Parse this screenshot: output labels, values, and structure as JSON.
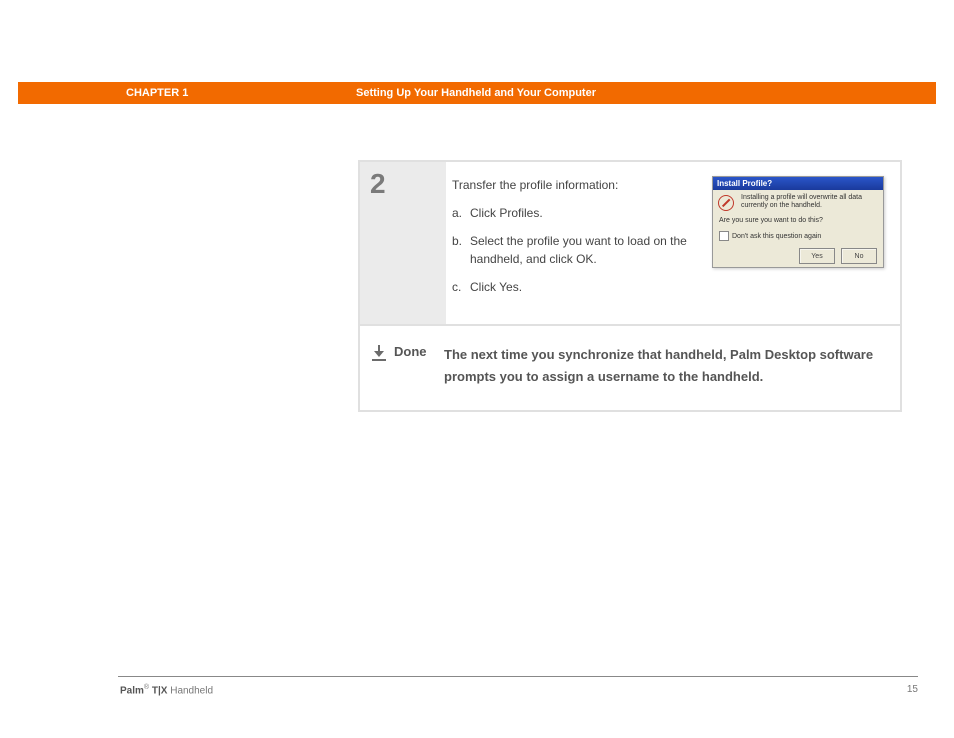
{
  "header": {
    "chapter": "CHAPTER 1",
    "title": "Setting Up Your Handheld and Your Computer"
  },
  "step": {
    "number": "2",
    "lead": "Transfer the profile information:",
    "subs": [
      {
        "label": "a.",
        "text": "Click Profiles."
      },
      {
        "label": "b.",
        "text": "Select the profile you want to load on the handheld, and click OK."
      },
      {
        "label": "c.",
        "text": "Click Yes."
      }
    ]
  },
  "dialog": {
    "title": "Install Profile?",
    "message": "Installing a profile will overwrite all data currently on the handheld.",
    "confirm": "Are you sure you want to do this?",
    "checkbox": "Don't ask this question again",
    "yes": "Yes",
    "no": "No"
  },
  "done": {
    "label": "Done",
    "text": "The next time you synchronize that handheld, Palm Desktop software prompts you to assign a username to the handheld."
  },
  "footer": {
    "brand": "Palm",
    "model": " T|X",
    "suffix": " Handheld",
    "page": "15"
  }
}
